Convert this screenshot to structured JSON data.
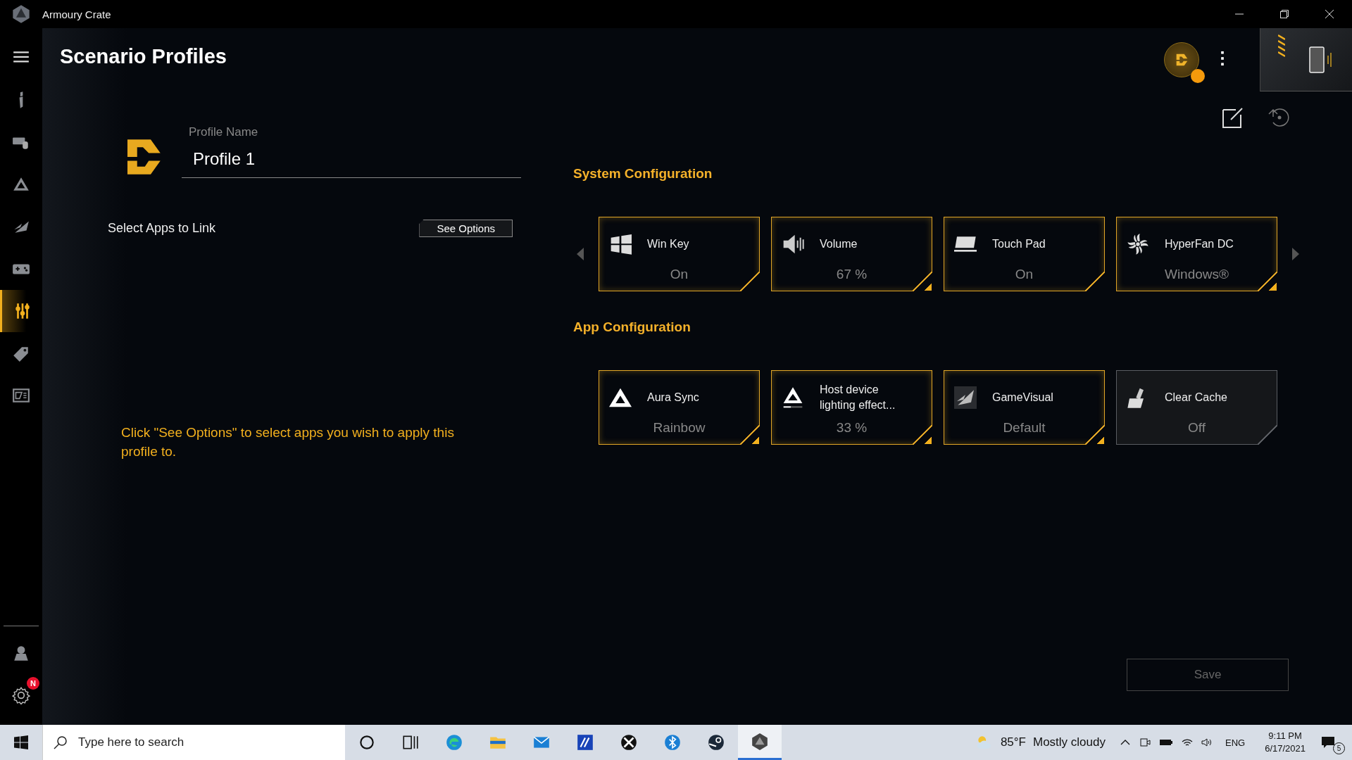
{
  "window": {
    "title": "Armoury Crate"
  },
  "sidebar": {
    "items": [
      {
        "kind": "menu",
        "selected": false
      },
      {
        "kind": "info",
        "selected": false
      },
      {
        "kind": "keyboard",
        "selected": false
      },
      {
        "kind": "aura",
        "selected": false
      },
      {
        "kind": "visual",
        "selected": false
      },
      {
        "kind": "gamepad",
        "selected": false
      },
      {
        "kind": "sliders",
        "selected": true
      },
      {
        "kind": "tag",
        "selected": false
      },
      {
        "kind": "news",
        "selected": false
      }
    ],
    "bottom_items": [
      {
        "kind": "user",
        "selected": false
      },
      {
        "kind": "settings",
        "selected": false,
        "badge": "N"
      }
    ]
  },
  "page": {
    "title": "Scenario Profiles"
  },
  "profile": {
    "label": "Profile Name",
    "value": "Profile 1"
  },
  "link_apps": {
    "label": "Select Apps to Link",
    "button": "See Options",
    "hint": "Click \"See Options\" to select apps you wish to apply this profile to."
  },
  "sections": [
    {
      "title": "System Configuration",
      "cards": [
        {
          "name": "Win Key",
          "value": "On",
          "enabled": true,
          "expandable": false
        },
        {
          "name": "Volume",
          "value": "67 %",
          "enabled": true,
          "expandable": true
        },
        {
          "name": "Touch Pad",
          "value": "On",
          "enabled": true,
          "expandable": false
        },
        {
          "name": "HyperFan DC",
          "value": "Windows®",
          "enabled": true,
          "expandable": true
        }
      ]
    },
    {
      "title": "App Configuration",
      "cards": [
        {
          "name": "Aura Sync",
          "value": "Rainbow",
          "enabled": true,
          "expandable": true
        },
        {
          "name": "Host device lighting effect...",
          "value": "33 %",
          "enabled": true,
          "expandable": true
        },
        {
          "name": "GameVisual",
          "value": "Default",
          "enabled": true,
          "expandable": true
        },
        {
          "name": "Clear Cache",
          "value": "Off",
          "enabled": false,
          "expandable": false
        }
      ]
    }
  ],
  "save_button": {
    "label": "Save",
    "disabled": true
  },
  "taskbar": {
    "search_placeholder": "Type here to search",
    "apps": [
      {
        "kind": "cortana",
        "active": false
      },
      {
        "kind": "taskview",
        "active": false
      },
      {
        "kind": "edge",
        "active": false
      },
      {
        "kind": "folder",
        "active": false
      },
      {
        "kind": "mail",
        "active": false
      },
      {
        "kind": "app",
        "active": false
      },
      {
        "kind": "xbox",
        "active": false
      },
      {
        "kind": "bt",
        "active": false
      },
      {
        "kind": "steam",
        "active": false
      },
      {
        "kind": "crate",
        "active": true
      }
    ],
    "weather": {
      "temp": "85°F",
      "condition": "Mostly cloudy"
    },
    "language": "ENG",
    "time": "9:11 PM",
    "date": "6/17/2021",
    "notifications": "5"
  }
}
